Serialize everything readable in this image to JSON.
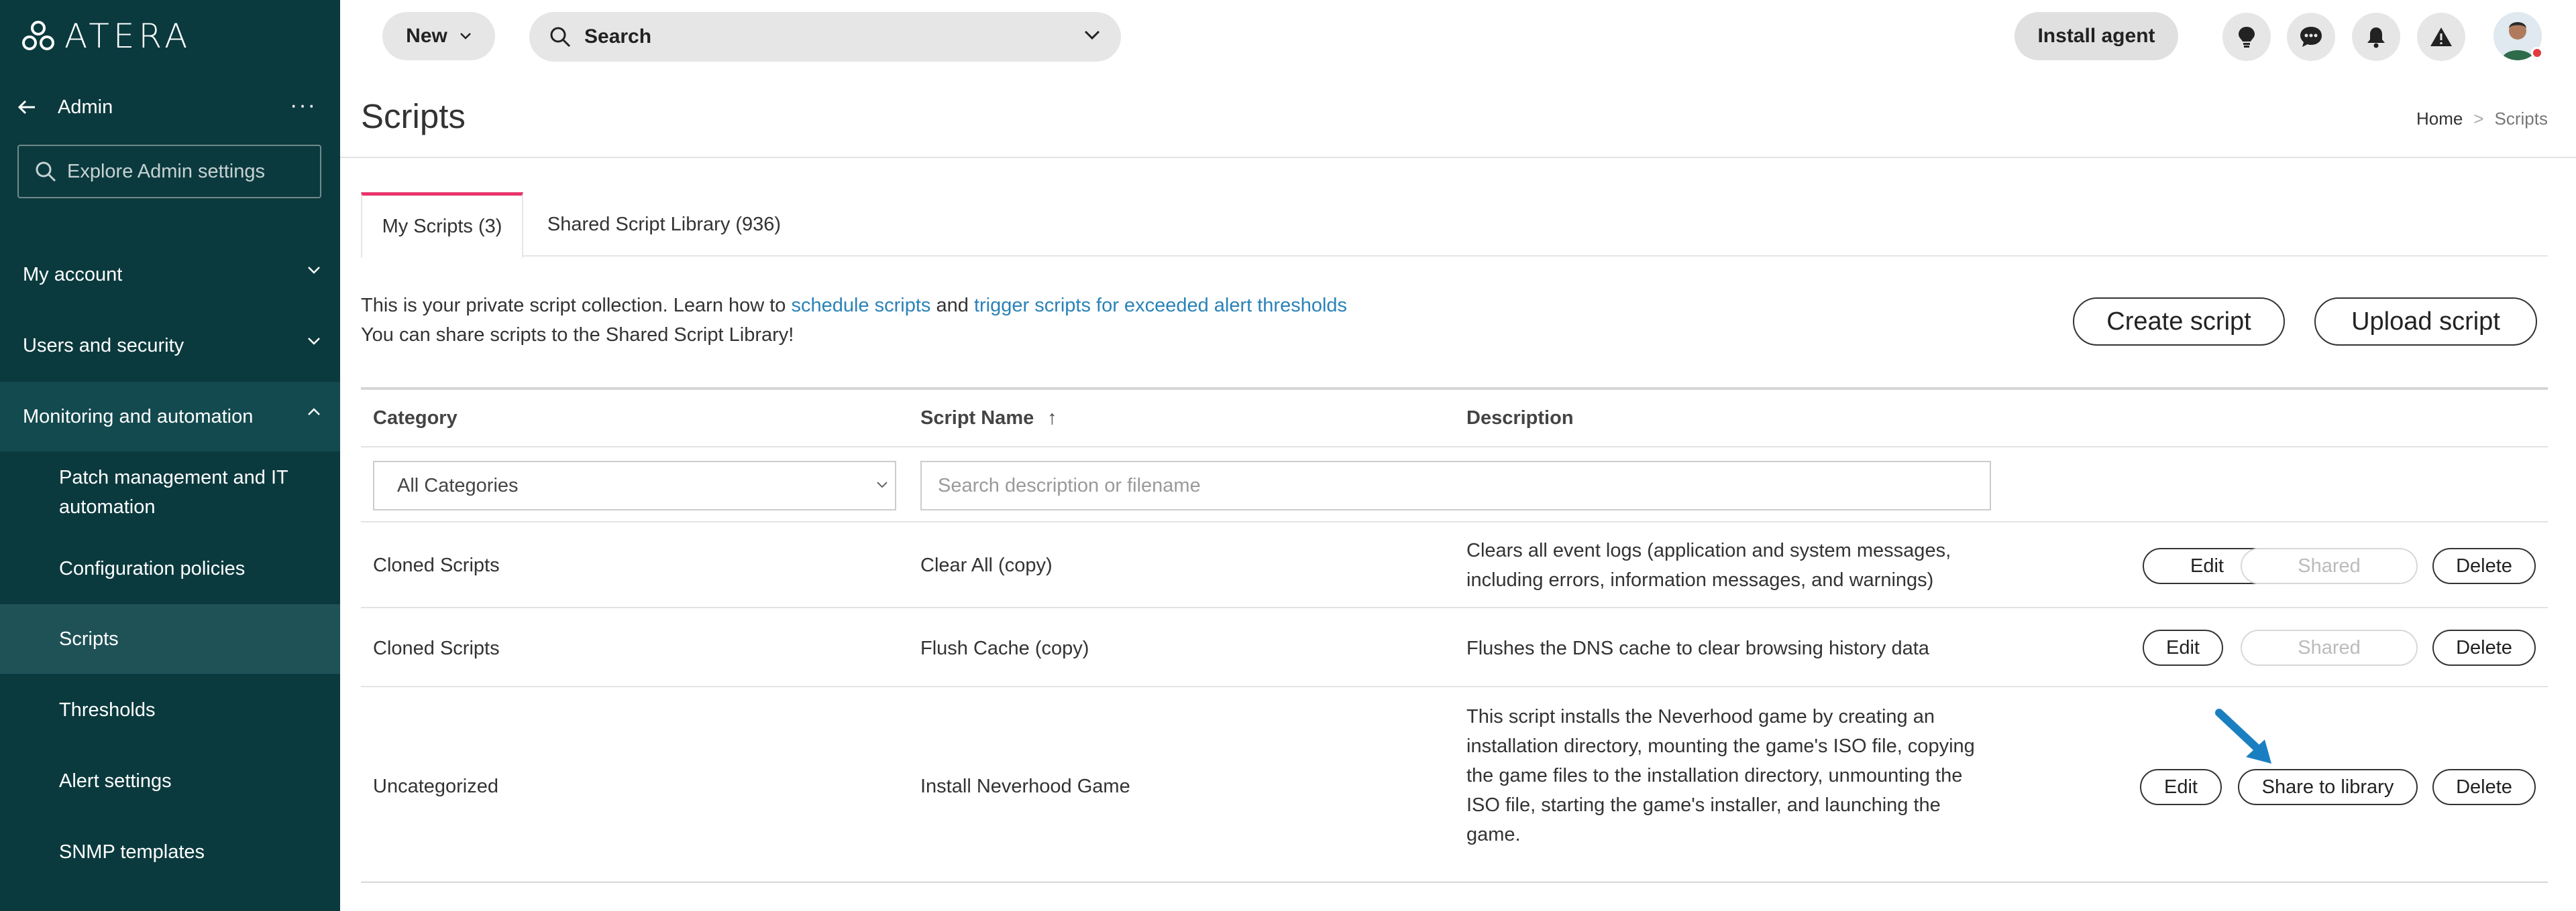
{
  "sidebar": {
    "logo_text": "ATERA",
    "admin_title": "Admin",
    "more_glyph": "···",
    "search_placeholder": "Explore Admin settings",
    "groups": [
      {
        "label": "My account"
      },
      {
        "label": "Users and security"
      },
      {
        "label": "Monitoring and automation"
      }
    ],
    "sub_items": [
      {
        "label": "Patch management and IT automation"
      },
      {
        "label": "Configuration policies"
      },
      {
        "label": "Scripts"
      },
      {
        "label": "Thresholds"
      },
      {
        "label": "Alert settings"
      },
      {
        "label": "SNMP templates"
      }
    ],
    "colors": {
      "background": "#0b3a3e",
      "active_item": "#1f5257"
    }
  },
  "topbar": {
    "new_label": "New",
    "search_label": "Search",
    "install_agent_label": "Install agent",
    "icons": [
      "lightbulb-icon",
      "chat-icon",
      "bell-icon",
      "warning-icon"
    ]
  },
  "page": {
    "title": "Scripts",
    "breadcrumb": {
      "home": "Home",
      "separator": ">",
      "current": "Scripts"
    }
  },
  "tabs": [
    {
      "label": "My Scripts (3)",
      "active": true
    },
    {
      "label": "Shared Script Library (936)",
      "active": false
    }
  ],
  "intro": {
    "line1_prefix": "This is your private script collection. Learn how to ",
    "link1": "schedule scripts",
    "and": " and ",
    "link2": "trigger scripts for exceeded alert thresholds",
    "line2": "You can share scripts to the Shared Script Library!"
  },
  "actions": {
    "create": "Create script",
    "upload": "Upload script"
  },
  "table": {
    "columns": [
      "Category",
      "Script Name",
      "Description"
    ],
    "sort_glyph": "↑",
    "category_filter_value": "All Categories",
    "search_placeholder": "Search description or filename",
    "rows": [
      {
        "category": "Cloned Scripts",
        "name": "Clear All (copy)",
        "description_lines": [
          "Clears all event logs (application and system messages,",
          "including errors, information messages, and warnings)"
        ],
        "edit": "Edit",
        "share": "Shared",
        "delete": "Delete"
      },
      {
        "category": "Cloned Scripts",
        "name": "Flush Cache (copy)",
        "description_lines": [
          "Flushes the DNS cache to clear browsing history data"
        ],
        "edit": "Edit",
        "share": "Shared",
        "delete": "Delete"
      },
      {
        "category": "Uncategorized",
        "name": "Install Neverhood Game",
        "description_lines": [
          "This script installs the Neverhood game by creating an",
          "installation directory, mounting the game's ISO file, copying",
          "the game files to the installation directory, unmounting the",
          "ISO file, starting the game's installer, and launching the",
          "game."
        ],
        "edit": "Edit",
        "share": "Share to library",
        "delete": "Delete"
      }
    ]
  },
  "colors": {
    "accent_tab": "#e8336b",
    "link": "#2a82b8",
    "annotation_arrow": "#1a7fc1"
  }
}
